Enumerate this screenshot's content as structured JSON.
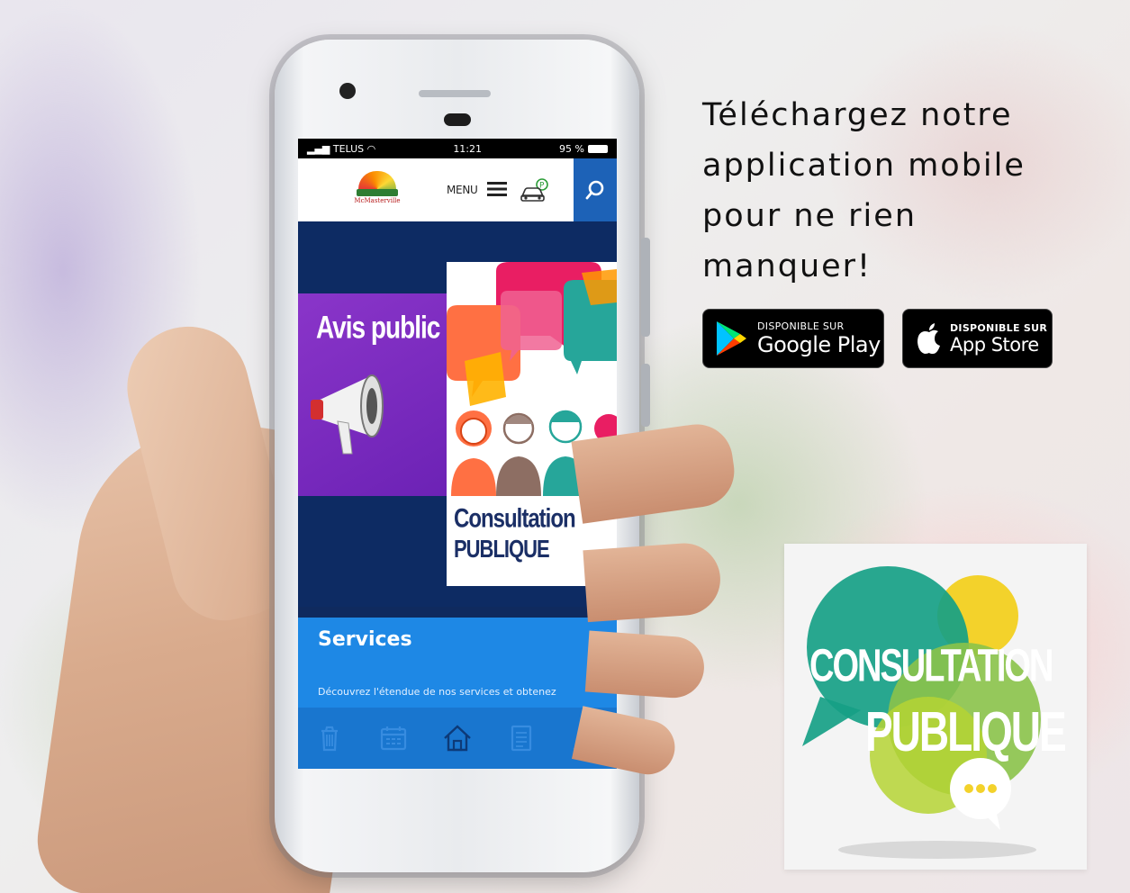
{
  "headline": {
    "line1": "Téléchargez notre",
    "line2": "application mobile",
    "line3": "pour ne rien",
    "line4": "manquer!"
  },
  "stores": {
    "google_play": {
      "small": "DISPONIBLE SUR",
      "big": "Google Play"
    },
    "app_store": {
      "small": "DISPONIBLE SUR",
      "big": "App Store"
    }
  },
  "phone_screen": {
    "status_bar": {
      "carrier": "TELUS",
      "time": "11:21",
      "battery": "95 %"
    },
    "app_bar": {
      "logo_name": "McMasterville",
      "menu_label": "MENU"
    },
    "banner": {
      "avis_title": "Avis public",
      "consultation_line1": "Consultation",
      "consultation_line2": "PUBLIQUE"
    },
    "services": {
      "title": "Services",
      "description": "Découvrez l'étendue de nos services et obtenez"
    },
    "bottom_nav": [
      "trash-icon",
      "calendar-icon",
      "home-icon",
      "document-icon",
      "bell-icon"
    ]
  },
  "consultation_card": {
    "line1": "CONSULTATION",
    "line2": "PUBLIQUE"
  },
  "colors": {
    "app_blue": "#1e88e5",
    "navy": "#0d2b63",
    "purple": "#7b2cbf",
    "search_blue": "#1d62b7"
  }
}
